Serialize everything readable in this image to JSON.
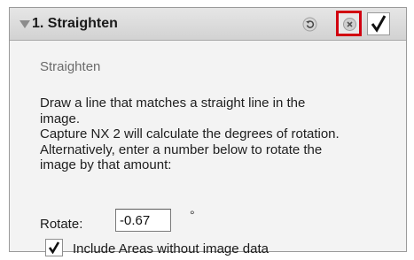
{
  "panel": {
    "title": "1. Straighten",
    "subtitle": "Straighten",
    "description_lines": [
      "Draw a line that matches a straight line in the",
      "image.",
      "Capture NX 2 will calculate the degrees of rotation.",
      "Alternatively, enter a number below to rotate the",
      "image by that amount:"
    ],
    "icons": {
      "collapse": "triangle-down-icon",
      "reset": "reset-icon",
      "close": "close-icon",
      "apply": "checkmark-icon"
    }
  },
  "rotate": {
    "label": "Rotate:",
    "value": "-0.67",
    "unit": "°"
  },
  "include_areas": {
    "label": "Include Areas without image data",
    "checked": true
  },
  "colors": {
    "highlight_border": "#d10010"
  }
}
